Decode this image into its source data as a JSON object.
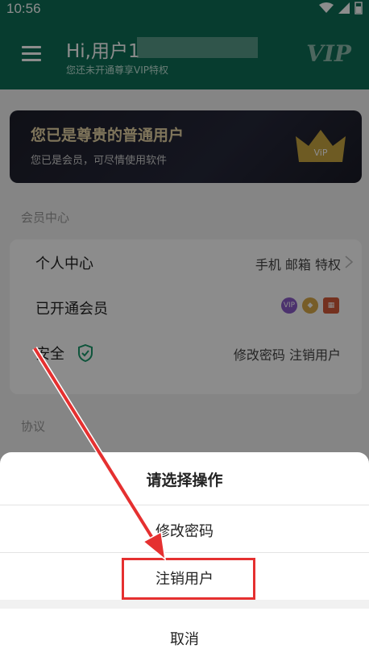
{
  "status_bar": {
    "time": "10:56"
  },
  "header": {
    "greeting": "Hi,用户1",
    "subtitle": "您还未开通尊享VIP特权",
    "vip_logo": "VIP",
    "menu_icon": "menu-icon"
  },
  "vip_card": {
    "title": "您已是尊贵的普通用户",
    "subtitle": "您已是会员，可尽情使用软件",
    "crown_text": "ViP"
  },
  "member_center": {
    "label": "会员中心",
    "rows": [
      {
        "label": "个人中心",
        "value": "手机 邮箱 特权"
      },
      {
        "label": "已开通会员",
        "badges": [
          "VIP",
          "diamond",
          "gift"
        ]
      },
      {
        "label": "安全",
        "value": "修改密码  注销用户"
      }
    ]
  },
  "agreement_label": "协议",
  "action_sheet": {
    "title": "请选择操作",
    "options": [
      "修改密码",
      "注销用户"
    ],
    "cancel": "取消"
  },
  "colors": {
    "header_bg": "#0e6d57",
    "highlight": "#e53030",
    "arrow": "#e53030"
  }
}
